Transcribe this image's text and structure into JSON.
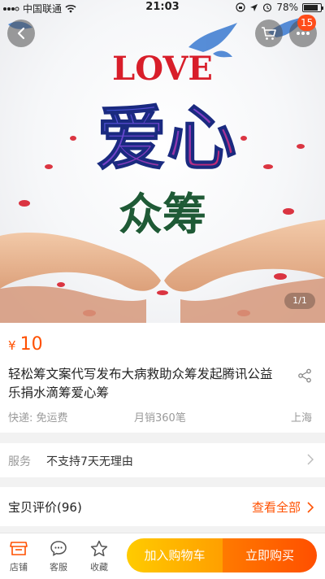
{
  "status_bar": {
    "carrier": "中国联通",
    "time": "21:03",
    "battery": "78%"
  },
  "hero": {
    "love_text": "LOVE",
    "headline": "爱心",
    "subheadline": "众筹",
    "image_counter": "1/1"
  },
  "header": {
    "notification_count": "15"
  },
  "product": {
    "price_symbol": "¥",
    "price": "10",
    "title": "轻松筹文案代写发布大病救助众筹发起腾讯公益乐捐水滴筹爱心筹",
    "shipping": "快递: 免运费",
    "monthly_sales": "月销360笔",
    "location": "上海"
  },
  "service": {
    "label": "服务",
    "value": "不支持7天无理由"
  },
  "reviews": {
    "label": "宝贝评价(96)",
    "view_all": "查看全部"
  },
  "bottom_bar": {
    "store": "店铺",
    "customer_service": "客服",
    "favorite": "收藏",
    "add_to_cart": "加入购物车",
    "buy_now": "立即购买"
  },
  "colors": {
    "accent": "#ff5000",
    "add_cart_gradient": [
      "#ffcb00",
      "#ff9f00"
    ],
    "buy_now_gradient": [
      "#ff7a00",
      "#ff4f00"
    ]
  },
  "icons": [
    "signal-icon",
    "wifi-icon",
    "lock-rotation-icon",
    "location-arrow-icon",
    "alarm-icon",
    "battery-icon",
    "back-arrow-icon",
    "cart-icon",
    "more-dots-icon",
    "share-icon",
    "chevron-right-icon",
    "store-icon",
    "chat-icon",
    "star-icon"
  ]
}
